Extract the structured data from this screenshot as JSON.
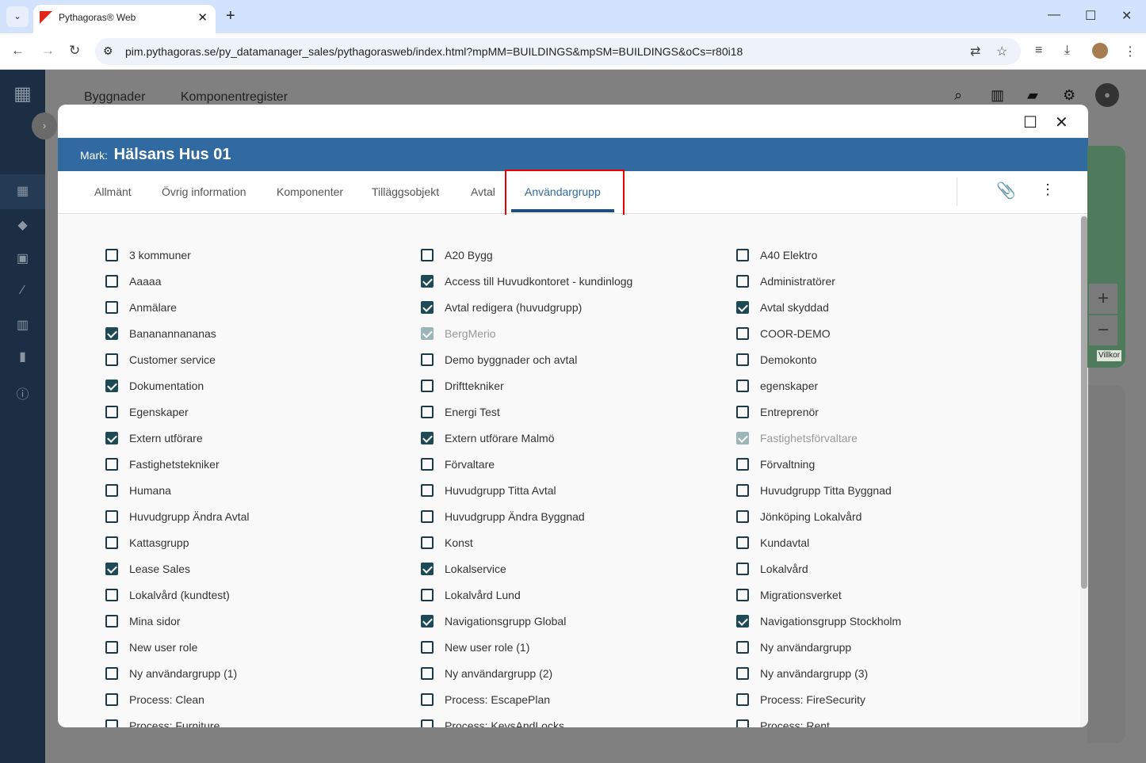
{
  "browser": {
    "tab_title": "Pythagoras® Web",
    "url": "pim.pythagoras.se/py_datamanager_sales/pythagorasweb/index.html?mpMM=BUILDINGS&mpSM=BUILDINGS&oCs=r80i18"
  },
  "app": {
    "nav": [
      "Byggnader",
      "Komponentregister"
    ],
    "map_terms": "Villkor"
  },
  "modal": {
    "prefix": "Mark:",
    "title": "Hälsans Hus 01",
    "tabs": [
      "Allmänt",
      "Övrig information",
      "Komponenter",
      "Tilläggsobjekt",
      "Avtal",
      "Användargrupp"
    ],
    "active_tab": "Användargrupp",
    "groups": [
      {
        "label": "3 kommuner",
        "checked": false
      },
      {
        "label": "A20 Bygg",
        "checked": false
      },
      {
        "label": "A40 Elektro",
        "checked": false
      },
      {
        "label": "Aaaaa",
        "checked": false
      },
      {
        "label": "Access till Huvudkontoret - kundinlogg",
        "checked": true
      },
      {
        "label": "Administratörer",
        "checked": false
      },
      {
        "label": "Anmälare",
        "checked": false
      },
      {
        "label": "Avtal redigera (huvudgrupp)",
        "checked": true
      },
      {
        "label": "Avtal skyddad",
        "checked": true
      },
      {
        "label": "Bananannananas",
        "checked": true
      },
      {
        "label": "BergMerio",
        "checked": true,
        "disabled": true
      },
      {
        "label": "COOR-DEMO",
        "checked": false
      },
      {
        "label": "Customer service",
        "checked": false
      },
      {
        "label": "Demo byggnader och avtal",
        "checked": false
      },
      {
        "label": "Demokonto",
        "checked": false
      },
      {
        "label": "Dokumentation",
        "checked": true
      },
      {
        "label": "Drifttekniker",
        "checked": false
      },
      {
        "label": "egenskaper",
        "checked": false
      },
      {
        "label": "Egenskaper",
        "checked": false
      },
      {
        "label": "Energi Test",
        "checked": false
      },
      {
        "label": "Entreprenör",
        "checked": false
      },
      {
        "label": "Extern utförare",
        "checked": true
      },
      {
        "label": "Extern utförare Malmö",
        "checked": true
      },
      {
        "label": "Fastighetsförvaltare",
        "checked": true,
        "disabled": true
      },
      {
        "label": "Fastighetstekniker",
        "checked": false
      },
      {
        "label": "Förvaltare",
        "checked": false
      },
      {
        "label": "Förvaltning",
        "checked": false
      },
      {
        "label": "Humana",
        "checked": false
      },
      {
        "label": "Huvudgrupp Titta Avtal",
        "checked": false
      },
      {
        "label": "Huvudgrupp Titta Byggnad",
        "checked": false
      },
      {
        "label": "Huvudgrupp Ändra Avtal",
        "checked": false
      },
      {
        "label": "Huvudgrupp Ändra Byggnad",
        "checked": false
      },
      {
        "label": "Jönköping Lokalvård",
        "checked": false
      },
      {
        "label": "Kattasgrupp",
        "checked": false
      },
      {
        "label": "Konst",
        "checked": false
      },
      {
        "label": "Kundavtal",
        "checked": false
      },
      {
        "label": "Lease Sales",
        "checked": true
      },
      {
        "label": "Lokalservice",
        "checked": true
      },
      {
        "label": "Lokalvård",
        "checked": false
      },
      {
        "label": "Lokalvård (kundtest)",
        "checked": false
      },
      {
        "label": "Lokalvård Lund",
        "checked": false
      },
      {
        "label": "Migrationsverket",
        "checked": false
      },
      {
        "label": "Mina sidor",
        "checked": false
      },
      {
        "label": "Navigationsgrupp Global",
        "checked": true
      },
      {
        "label": "Navigationsgrupp Stockholm",
        "checked": true
      },
      {
        "label": "New user role",
        "checked": false
      },
      {
        "label": "New user role (1)",
        "checked": false
      },
      {
        "label": "Ny användargrupp",
        "checked": false
      },
      {
        "label": "Ny användargrupp (1)",
        "checked": false
      },
      {
        "label": "Ny användargrupp (2)",
        "checked": false
      },
      {
        "label": "Ny användargrupp (3)",
        "checked": false
      },
      {
        "label": "Process: Clean",
        "checked": false
      },
      {
        "label": "Process: EscapePlan",
        "checked": false
      },
      {
        "label": "Process: FireSecurity",
        "checked": false
      },
      {
        "label": "Process: Furniture",
        "checked": false
      },
      {
        "label": "Process: KeysAndLocks",
        "checked": false
      },
      {
        "label": "Process: Rent",
        "checked": false
      }
    ]
  }
}
